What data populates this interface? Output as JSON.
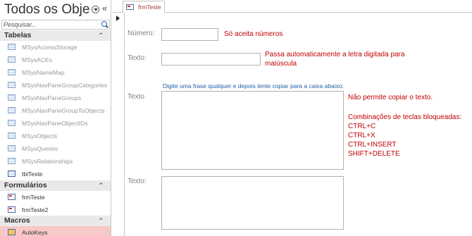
{
  "nav": {
    "title": "Todos os Objet…",
    "search_placeholder": "Pesquisar...",
    "groups": {
      "tables": "Tabelas",
      "forms": "Formulários",
      "macros": "Macros"
    },
    "tables": [
      "MSysAccessStorage",
      "MSysACEs",
      "MSysNameMap",
      "MSysNavPaneGroupCategories",
      "MSysNavPaneGroups",
      "MSysNavPaneGroupToObjects",
      "MSysNavPaneObjectIDs",
      "MSysObjects",
      "MSysQueries",
      "MSysRelationships",
      "tblTeste"
    ],
    "forms": [
      "frmTeste",
      "frmTeste2"
    ],
    "macros": [
      "AutoKeys"
    ]
  },
  "tab": {
    "label": "frmTeste"
  },
  "form": {
    "numero_label": "Número:",
    "numero_note": "Só aceita números",
    "texto1_label": "Texto:",
    "texto1_note_line1": "Passa automaticamente  a letra digitada para",
    "texto1_note_line2": "maiúscula",
    "hint": "Digite uma frase qualquer e depois tente copiar para a caixa abaixo:",
    "texto2_label": "Texto",
    "copy_note": "Não permite copiar o texto.",
    "combos_title": "Combinações de teclas bloqueadas:",
    "combos": [
      "CTRL+C",
      "CTRL+X",
      "CTRL+INSERT",
      "SHIFT+DELETE"
    ],
    "texto3_label": "Texto:"
  },
  "colors": {
    "accent_red": "#c00000",
    "hint_blue": "#1f5fa8",
    "selected_item": "#f7c8c8"
  }
}
